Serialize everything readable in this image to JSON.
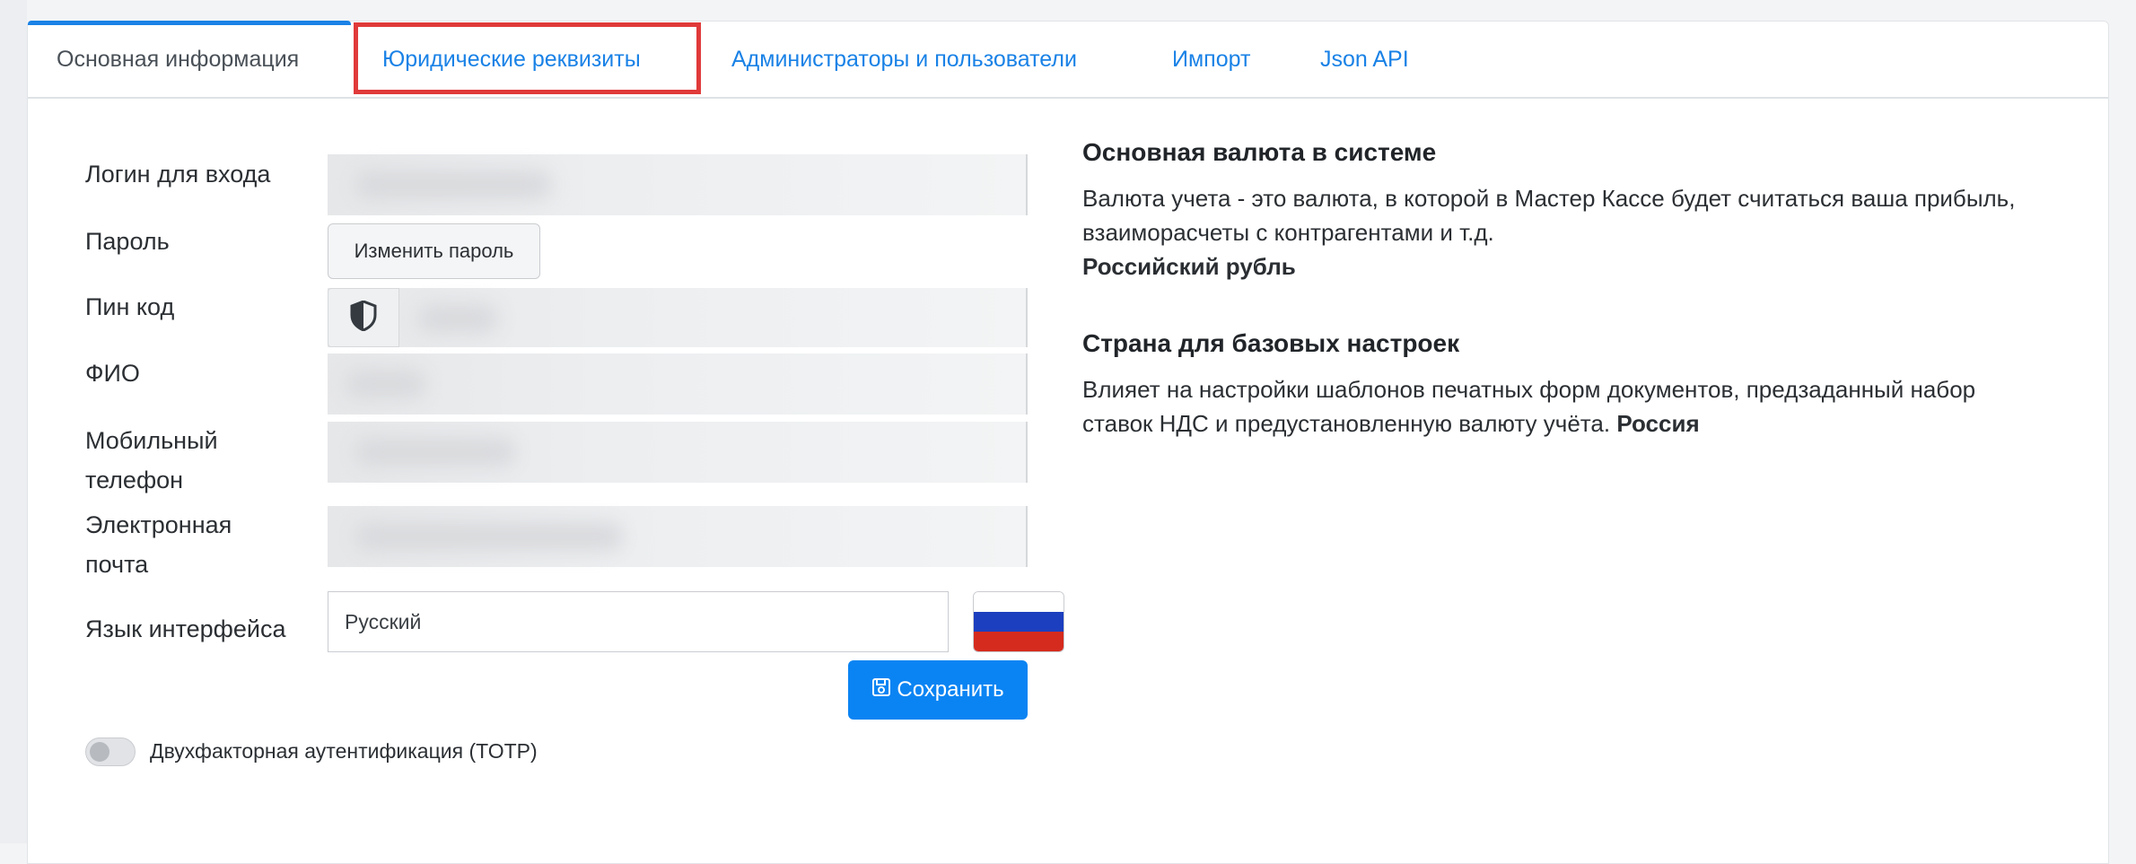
{
  "tabs": [
    {
      "label": "Основная информация",
      "active": true
    },
    {
      "label": "Юридические реквизиты",
      "active": false,
      "highlighted": true
    },
    {
      "label": "Администраторы и пользователи",
      "active": false
    },
    {
      "label": "Импорт",
      "active": false
    },
    {
      "label": "Json API",
      "active": false
    }
  ],
  "form": {
    "login_label": "Логин для входа",
    "password_label": "Пароль",
    "change_password_button": "Изменить пароль",
    "pin_label": "Пин код",
    "fio_label": "ФИО",
    "mobile_label_line1": "Мобильный",
    "mobile_label_line2": "телефон",
    "email_label_line1": "Электронная",
    "email_label_line2": "почта",
    "language_label": "Язык интерфейса",
    "language_value": "Русский",
    "save_button": "Сохранить",
    "two_factor_label": "Двухфакторная аутентификация (TOTP)",
    "two_factor_enabled": false
  },
  "info": {
    "currency_title": "Основная валюта в системе",
    "currency_text_line1": "Валюта учета - это валюта, в которой в Мастер Кассе будет считаться ваша прибыль,",
    "currency_text_line2": "взаиморасчеты с контрагентами и т.д.",
    "currency_value": "Российский рубль",
    "country_title": "Страна для базовых настроек",
    "country_text_line1": "Влияет на настройки шаблонов печатных форм документов, предзаданный набор",
    "country_text_line2": "ставок НДС и предустановленную валюту учёта.",
    "country_value": "Россия"
  },
  "colors": {
    "accent": "#1a82e6",
    "save_button": "#0b84f3",
    "highlight": "#e03a3a",
    "flag_white": "#ffffff",
    "flag_blue": "#1c3fbf",
    "flag_red": "#d52b1e"
  },
  "icons": {
    "pin": "shield-icon",
    "save": "floppy-disk-icon"
  }
}
